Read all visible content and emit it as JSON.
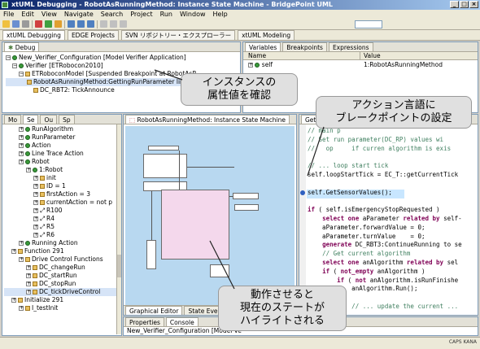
{
  "window": {
    "title": "xtUML Debugging - RobotAsRunningMethod: Instance State Machine - BridgePoint UML"
  },
  "menu": [
    "File",
    "Edit",
    "View",
    "Navigate",
    "Search",
    "Project",
    "Run",
    "Window",
    "Help"
  ],
  "perspectives": [
    "xtUML Debugging",
    "EDGE Projects",
    "SVN リポジトリー・エクスプローラー",
    "xtUML Modeling"
  ],
  "debug": {
    "tab": "Debug",
    "items": [
      "New_Verifier_Configuration [Model Verifier Application]",
      "Verifier [ETRobocon2010]",
      "ETRoboconModel [Suspended Breakpoint at RobotAsR",
      "RobotAsRunningMethod:GettingRunParameter line",
      "DC_RBT2: TickAnnounce"
    ]
  },
  "variables": {
    "tabs": [
      "Variables",
      "Breakpoints",
      "Expressions"
    ],
    "headers": [
      "Name",
      "Value"
    ],
    "rows": [
      {
        "name": "self",
        "value": "1:RobotAsRunningMethod"
      }
    ]
  },
  "explorer": {
    "tabs": [
      "Mo",
      "Se",
      "Ou",
      "Sp"
    ],
    "items": [
      {
        "t": "RunAlgorithm",
        "d": 2,
        "i": "g"
      },
      {
        "t": "RunParameter",
        "d": 2,
        "i": "g"
      },
      {
        "t": "Action",
        "d": 2,
        "i": "g"
      },
      {
        "t": "Line Trace Action",
        "d": 2,
        "i": "g"
      },
      {
        "t": "Robot",
        "d": 2,
        "i": "g"
      },
      {
        "t": "1:Robot",
        "d": 3,
        "i": "g"
      },
      {
        "t": "init",
        "d": 4,
        "i": "s"
      },
      {
        "t": "ID = 1",
        "d": 4,
        "i": "s"
      },
      {
        "t": "firstAction = 3",
        "d": 4,
        "i": "s"
      },
      {
        "t": "currentAction = not p",
        "d": 4,
        "i": "s"
      },
      {
        "t": "R100",
        "d": 4,
        "i": "r"
      },
      {
        "t": "R4",
        "d": 4,
        "i": "r"
      },
      {
        "t": "R5",
        "d": 4,
        "i": "r"
      },
      {
        "t": "R6",
        "d": 4,
        "i": "r"
      },
      {
        "t": "Running Action",
        "d": 2,
        "i": "g"
      },
      {
        "t": "Function 291",
        "d": 1,
        "i": "f"
      },
      {
        "t": "Drive Control Functions",
        "d": 2,
        "i": "f"
      },
      {
        "t": "DC_changeRun",
        "d": 3,
        "i": "s"
      },
      {
        "t": "DC_startRun",
        "d": 3,
        "i": "s"
      },
      {
        "t": "DC_stopRun",
        "d": 3,
        "i": "s"
      },
      {
        "t": "DC_tickDriveControl",
        "d": 3,
        "i": "s"
      },
      {
        "t": "Initialize 291",
        "d": 1,
        "i": "f"
      },
      {
        "t": "I_testInit",
        "d": 2,
        "i": "s"
      }
    ]
  },
  "diagram": {
    "tab": "RobotAsRunningMethod: Instance State Machine",
    "bottom_tabs": [
      "Graphical Editor",
      "State Event Matrix"
    ]
  },
  "editor": {
    "tab": "Get",
    "lines": [
      [
        [
          "cm",
          "// main p"
        ]
      ],
      [
        [
          "cm",
          "// Set run parameter(DC_RP) values wi"
        ]
      ],
      [
        [
          "cm",
          "//   op     if curren algorithm is exis"
        ]
      ],
      [
        [
          "",
          ""
        ]
      ],
      [
        [
          "cm",
          "// ... loop start tick"
        ]
      ],
      [
        [
          "",
          "self.loopStartTick = EC_T::getCurrentTick"
        ]
      ],
      [
        [
          "",
          ""
        ]
      ],
      [
        [
          "",
          "self.GetSensorValues();"
        ]
      ],
      [
        [
          "",
          ""
        ]
      ],
      [
        [
          "kw",
          "if"
        ],
        [
          "",
          " ( self.isEmergencyStopRequested )"
        ]
      ],
      [
        [
          "",
          "    "
        ],
        [
          "kw",
          "select one"
        ],
        [
          "",
          " aParameter "
        ],
        [
          "kw",
          "related by"
        ],
        [
          "",
          " self-"
        ]
      ],
      [
        [
          "",
          "    aParameter.forwardValue = 0;"
        ]
      ],
      [
        [
          "",
          "    aParameter.turnValue    = 0;"
        ]
      ],
      [
        [
          "",
          "    "
        ],
        [
          "kw",
          "generate"
        ],
        [
          "",
          " DC_RBT3:ContinueRunning to se"
        ]
      ],
      [
        [
          "",
          "    "
        ],
        [
          "cm",
          "// Get current algorithm"
        ]
      ],
      [
        [
          "",
          "    "
        ],
        [
          "kw",
          "select one"
        ],
        [
          "",
          " anAlgorithm "
        ],
        [
          "kw",
          "related by"
        ],
        [
          "",
          " sel"
        ]
      ],
      [
        [
          "",
          "    "
        ],
        [
          "kw",
          "if"
        ],
        [
          "",
          " ( "
        ],
        [
          "kw",
          "not_empty"
        ],
        [
          "",
          " anAlgorithm )"
        ]
      ],
      [
        [
          "",
          "        "
        ],
        [
          "kw",
          "if"
        ],
        [
          "",
          " ( "
        ],
        [
          "kw",
          "not"
        ],
        [
          "",
          " anAlgorithm.isRunFinishe"
        ]
      ],
      [
        [
          "",
          "            anAlgorithm.Run();"
        ]
      ],
      [
        [
          "",
          ""
        ]
      ],
      [
        [
          "cm",
          "            // ... update the current ..."
        ]
      ]
    ]
  },
  "console": {
    "tabs": [
      "Properties",
      "Console"
    ],
    "text": "New_Verifier_Configuration [Model Ve"
  },
  "callouts": {
    "c1": [
      "インスタンスの",
      "属性値を確認"
    ],
    "c2": [
      "アクション言語に",
      "ブレークポイントの設定"
    ],
    "c3": [
      "動作させると",
      "現在のステートが",
      "ハイライトされる"
    ]
  },
  "status": {
    "ime": "CAPS KANA"
  }
}
